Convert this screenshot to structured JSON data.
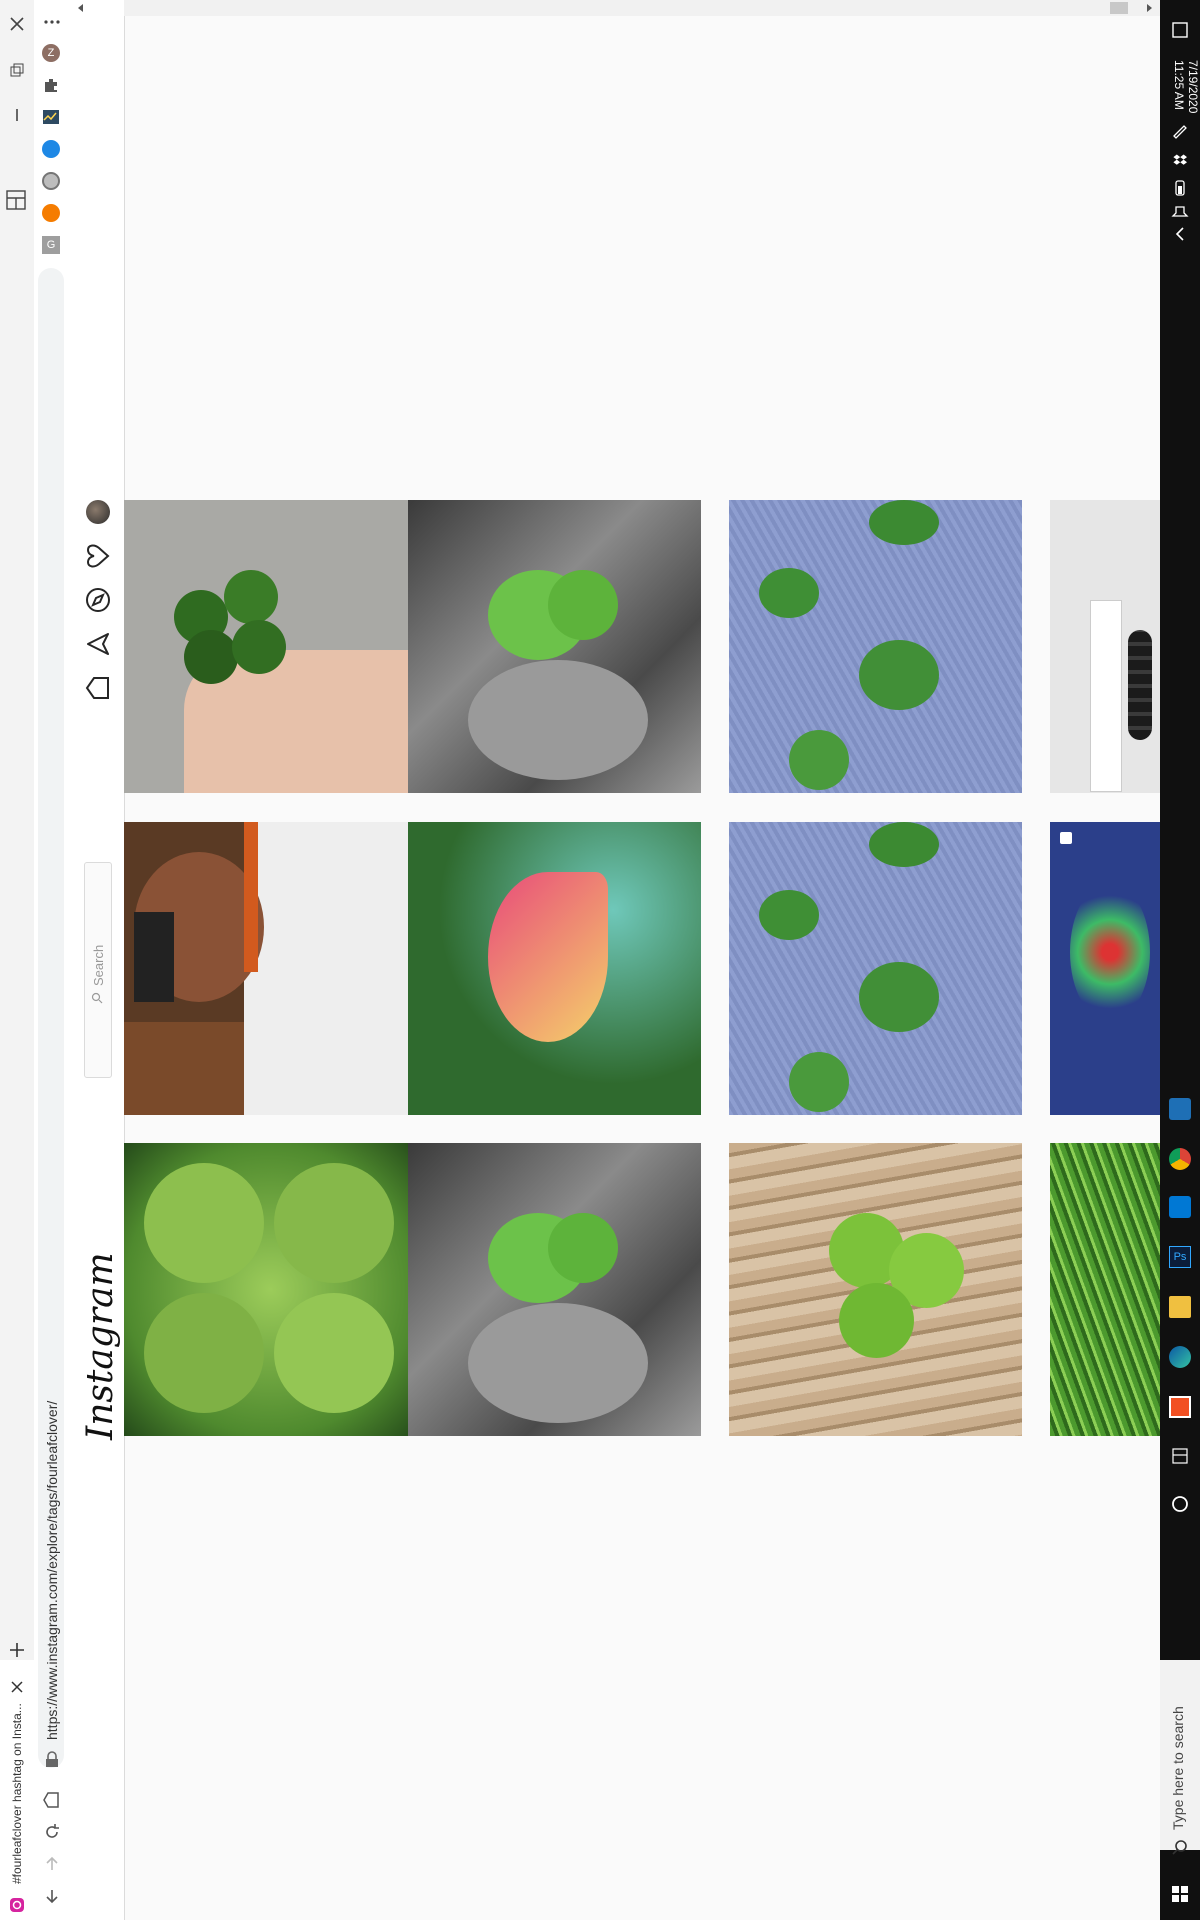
{
  "tab": {
    "title": "#fourleafclover hashtag on Insta..."
  },
  "address_bar": {
    "url": "https://www.instagram.com/explore/tags/fourleafclover/"
  },
  "ig": {
    "logo": "Instagram",
    "search_placeholder": "Search"
  },
  "taskbar": {
    "search_placeholder": "Type here to search",
    "time": "11:25 AM",
    "date": "7/19/2020"
  },
  "extensions": [
    "Z",
    "puzzle",
    "chart",
    "circle-blue",
    "circle-gray",
    "circle-orange",
    "G"
  ],
  "colors": {
    "taskbar_bg": "#101010",
    "page_bg": "#fafafa",
    "ig_border": "#dbdbdb"
  },
  "grid": {
    "rows": [
      [
        {
          "desc": "hand holding four leaf clover"
        },
        {
          "desc": "clover with black and white background"
        },
        {
          "desc": "clovers on denim"
        },
        {
          "desc": "anxiety and stress keyring"
        }
      ],
      [
        {
          "desc": "person wearing sunglasses"
        },
        {
          "desc": "pink and yellow oxalis"
        },
        {
          "desc": "clovers on denim"
        },
        {
          "desc": "clover painting"
        }
      ],
      [
        {
          "desc": "large green four leaf clover"
        },
        {
          "desc": "clover with black and white background"
        },
        {
          "desc": "clover on wooden plank"
        },
        {
          "desc": "clover in grass"
        }
      ]
    ]
  }
}
